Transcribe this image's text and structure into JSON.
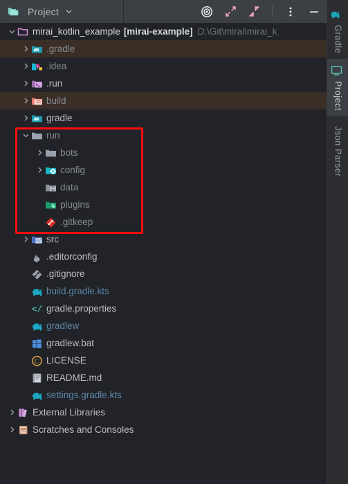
{
  "window": {
    "tool_window_title": "Project",
    "accent_red": "#fb0d0d",
    "excluded_bg": "#3a2e26",
    "toolbar_bg": "#3c3f44",
    "panel_bg": "#212328"
  },
  "toolbar": {
    "title": "Project",
    "dropdown_icon": "chevron-down-icon",
    "actions": [
      {
        "name": "select-opened-file-icon",
        "tooltip": "Select Opened File"
      },
      {
        "name": "expand-all-icon",
        "tooltip": "Expand All"
      },
      {
        "name": "collapse-all-icon",
        "tooltip": "Collapse All"
      },
      {
        "name": "more-options-icon",
        "tooltip": "Options"
      },
      {
        "name": "hide-icon",
        "tooltip": "Hide"
      }
    ]
  },
  "right_stripe": {
    "tabs": [
      {
        "label": "Gradle",
        "icon": "gradle-elephant-icon",
        "active": false
      },
      {
        "label": "Project",
        "icon": "project-monitor-icon",
        "active": true
      },
      {
        "label": "Json Parser",
        "icon": "none",
        "active": false
      }
    ]
  },
  "tree": {
    "root": {
      "name": "mirai_kotlin_example",
      "module": "[mirai-example]",
      "path": "D:\\Git\\mirai\\mirai_k",
      "icon": "project-folder-icon",
      "expanded": true
    },
    "nodes": [
      {
        "label": ".gradle",
        "icon": "folder-gradle-icon",
        "indent": 1,
        "arrow": "collapsed",
        "excluded": true,
        "style": "muted"
      },
      {
        "label": ".idea",
        "icon": "folder-idea-icon",
        "indent": 1,
        "arrow": "collapsed",
        "excluded": false,
        "style": "muted"
      },
      {
        "label": ".run",
        "icon": "folder-run-icon",
        "indent": 1,
        "arrow": "collapsed",
        "excluded": false,
        "style": "normal"
      },
      {
        "label": "build",
        "icon": "folder-build-icon",
        "indent": 1,
        "arrow": "collapsed",
        "excluded": true,
        "style": "muted"
      },
      {
        "label": "gradle",
        "icon": "folder-gradle-icon",
        "indent": 1,
        "arrow": "collapsed",
        "excluded": false,
        "style": "normal"
      },
      {
        "label": "run",
        "icon": "folder-plain-icon",
        "indent": 1,
        "arrow": "expanded",
        "excluded": false,
        "style": "muted"
      },
      {
        "label": "bots",
        "icon": "folder-plain-icon",
        "indent": 2,
        "arrow": "collapsed",
        "excluded": false,
        "style": "muted"
      },
      {
        "label": "config",
        "icon": "folder-config-icon",
        "indent": 2,
        "arrow": "collapsed",
        "excluded": false,
        "style": "muted"
      },
      {
        "label": "data",
        "icon": "folder-data-icon",
        "indent": 2,
        "arrow": "none",
        "excluded": false,
        "style": "muted"
      },
      {
        "label": "plugins",
        "icon": "folder-plugins-icon",
        "indent": 2,
        "arrow": "none",
        "excluded": false,
        "style": "muted"
      },
      {
        "label": ".gitkeep",
        "icon": "git-file-red-icon",
        "indent": 2,
        "arrow": "none",
        "excluded": false,
        "style": "muted"
      },
      {
        "label": "src",
        "icon": "folder-source-icon",
        "indent": 1,
        "arrow": "collapsed",
        "excluded": false,
        "style": "normal"
      },
      {
        "label": ".editorconfig",
        "icon": "editorconfig-icon",
        "indent": 1,
        "arrow": "none",
        "excluded": false,
        "style": "normal"
      },
      {
        "label": ".gitignore",
        "icon": "git-file-grey-icon",
        "indent": 1,
        "arrow": "none",
        "excluded": false,
        "style": "normal"
      },
      {
        "label": "build.gradle.kts",
        "icon": "gradle-script-icon",
        "indent": 1,
        "arrow": "none",
        "excluded": false,
        "style": "blue"
      },
      {
        "label": "gradle.properties",
        "icon": "properties-icon",
        "indent": 1,
        "arrow": "none",
        "excluded": false,
        "style": "normal"
      },
      {
        "label": "gradlew",
        "icon": "gradle-script-icon",
        "indent": 1,
        "arrow": "none",
        "excluded": false,
        "style": "blue"
      },
      {
        "label": "gradlew.bat",
        "icon": "windows-bat-icon",
        "indent": 1,
        "arrow": "none",
        "excluded": false,
        "style": "normal"
      },
      {
        "label": "LICENSE",
        "icon": "license-icon",
        "indent": 1,
        "arrow": "none",
        "excluded": false,
        "style": "normal"
      },
      {
        "label": "README.md",
        "icon": "readme-icon",
        "indent": 1,
        "arrow": "none",
        "excluded": false,
        "style": "normal"
      },
      {
        "label": "settings.gradle.kts",
        "icon": "gradle-script-icon",
        "indent": 1,
        "arrow": "none",
        "excluded": false,
        "style": "blue"
      },
      {
        "label": "External Libraries",
        "icon": "external-libraries-icon",
        "indent": 0,
        "arrow": "collapsed",
        "excluded": false,
        "style": "normal"
      },
      {
        "label": "Scratches and Consoles",
        "icon": "scratches-icon",
        "indent": 0,
        "arrow": "collapsed",
        "excluded": false,
        "style": "normal"
      }
    ]
  },
  "annotation": {
    "shape": "rectangle",
    "color": "#fb0d0d",
    "encloses": [
      "run",
      "bots",
      "config",
      "data",
      "plugins",
      ".gitkeep"
    ]
  }
}
